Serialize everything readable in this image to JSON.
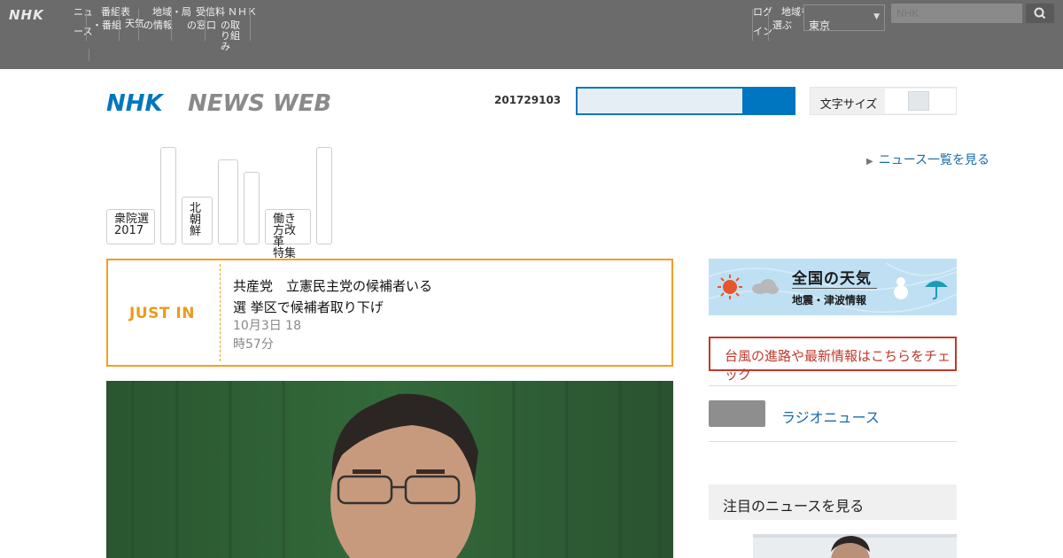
{
  "global_nav": {
    "logo": "NHK",
    "items": [
      {
        "l1": "ニュ",
        "l2": "ース"
      },
      {
        "l1": "番組表",
        "l2": "・番組"
      },
      {
        "l1": "天気",
        "l2": ""
      },
      {
        "l1": "地域・局",
        "l2": "の情報"
      },
      {
        "l1": "受信料",
        "l2": "の窓口"
      },
      {
        "l1": "ＮＨＫ",
        "l2": "の取り組み"
      }
    ],
    "right_items": [
      {
        "l1": "ログ",
        "l2": "イン"
      },
      {
        "l1": "地域を",
        "l2": "選ぶ"
      }
    ],
    "region_value": "東京",
    "search_placeholder": "NHK"
  },
  "header": {
    "logo_nhk": "NHK",
    "logo_newsweb": "NEWS WEB",
    "date": "201729103",
    "search_placeholder": "",
    "toggle_label": "文字サイズ"
  },
  "top_link": "ニュース一覧を見る",
  "category_tabs": [
    {
      "l1": "衆院選",
      "l2": "2017"
    },
    {
      "l1": "",
      "l2": ""
    },
    {
      "l1": "北朝",
      "l2": "鮮"
    },
    {
      "l1": "",
      "l2": ""
    },
    {
      "l1": "",
      "l2": ""
    },
    {
      "l1": "働き方改革",
      "l2": "特集"
    },
    {
      "l1": "",
      "l2": ""
    }
  ],
  "just_in": {
    "label": "JUST IN",
    "title_line1": "共産党　立憲民主党の候補者いる",
    "title_line2": "選 挙区で候補者取り下げ",
    "time_line1": "10月3日 18",
    "time_line2": "時57分"
  },
  "weather": {
    "title": "全国の天気",
    "subtitle": "地震・津波情報"
  },
  "alert_text": "台風の進路や最新情報はこちらをチェック",
  "grey_link": "ラジオニュース",
  "section_head": "注目のニュースを見る",
  "colors": {
    "accent_blue": "#0076c0",
    "justin_orange": "#eb9b1d",
    "alert_red": "#c0392b",
    "global_bar": "#6b6b6b"
  }
}
